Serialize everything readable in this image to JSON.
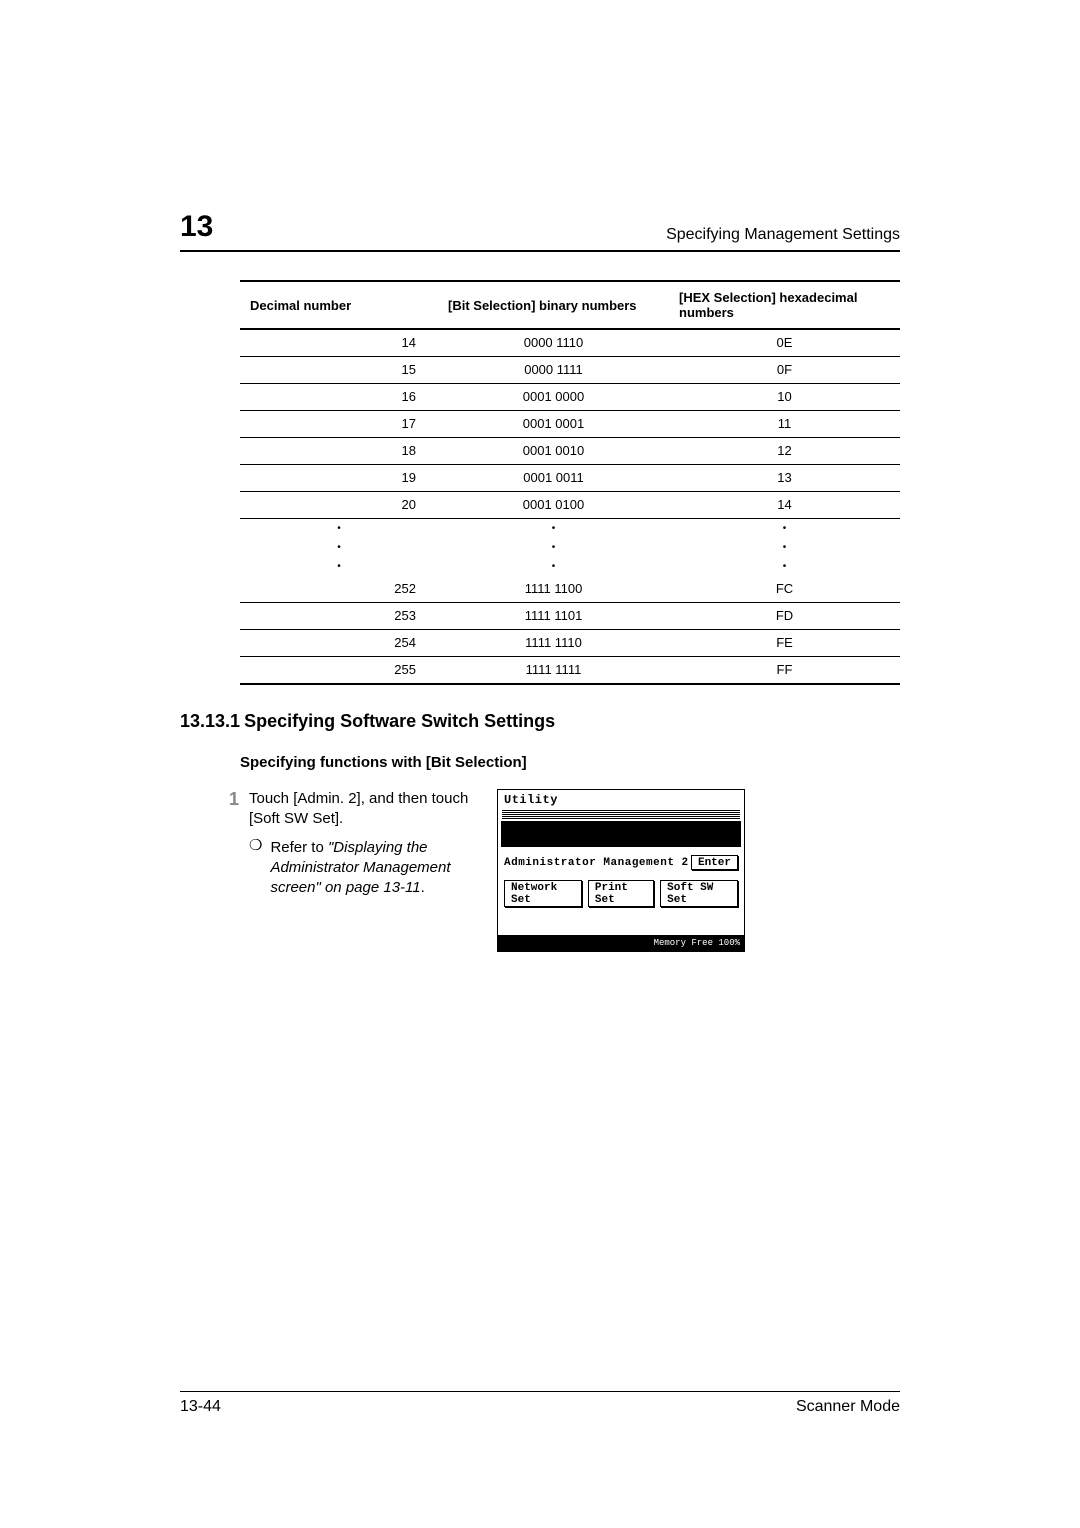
{
  "header": {
    "chapter": "13",
    "title": "Specifying Management Settings"
  },
  "table": {
    "headers": {
      "c1": "Decimal number",
      "c2": "[Bit Selection] binary numbers",
      "c3": "[HEX Selection] hexadecimal numbers"
    },
    "rows": [
      {
        "d": "14",
        "b": "0000 1110",
        "h": "0E"
      },
      {
        "d": "15",
        "b": "0000 1111",
        "h": "0F"
      },
      {
        "d": "16",
        "b": "0001 0000",
        "h": "10"
      },
      {
        "d": "17",
        "b": "0001 0001",
        "h": "11"
      },
      {
        "d": "18",
        "b": "0001 0010",
        "h": "12"
      },
      {
        "d": "19",
        "b": "0001 0011",
        "h": "13"
      },
      {
        "d": "20",
        "b": "0001 0100",
        "h": "14"
      }
    ],
    "ellipsis": "•",
    "rows2": [
      {
        "d": "252",
        "b": "1111 1100",
        "h": "FC"
      },
      {
        "d": "253",
        "b": "1111 1101",
        "h": "FD"
      },
      {
        "d": "254",
        "b": "1111 1110",
        "h": "FE"
      },
      {
        "d": "255",
        "b": "1111 1111",
        "h": "FF"
      }
    ]
  },
  "section": {
    "number": "13.13.1",
    "title": "Specifying Software Switch Settings",
    "sub": "Specifying functions with [Bit Selection]"
  },
  "step": {
    "num": "1",
    "text": "Touch [Admin. 2], and then touch [Soft SW Set].",
    "note_mark": "❍",
    "note_prefix": "Refer to ",
    "note_italic": "\"Displaying the Administrator Management screen\" on page 13-11",
    "note_suffix": "."
  },
  "lcd": {
    "title": "Utility",
    "line1_label": "Administrator Management 2",
    "enter": "Enter",
    "b1": "Network Set",
    "b2": "Print Set",
    "b3": "Soft SW Set",
    "mem_label": "Memory Free",
    "mem_value": "100%"
  },
  "footer": {
    "page": "13-44",
    "mode": "Scanner Mode"
  }
}
